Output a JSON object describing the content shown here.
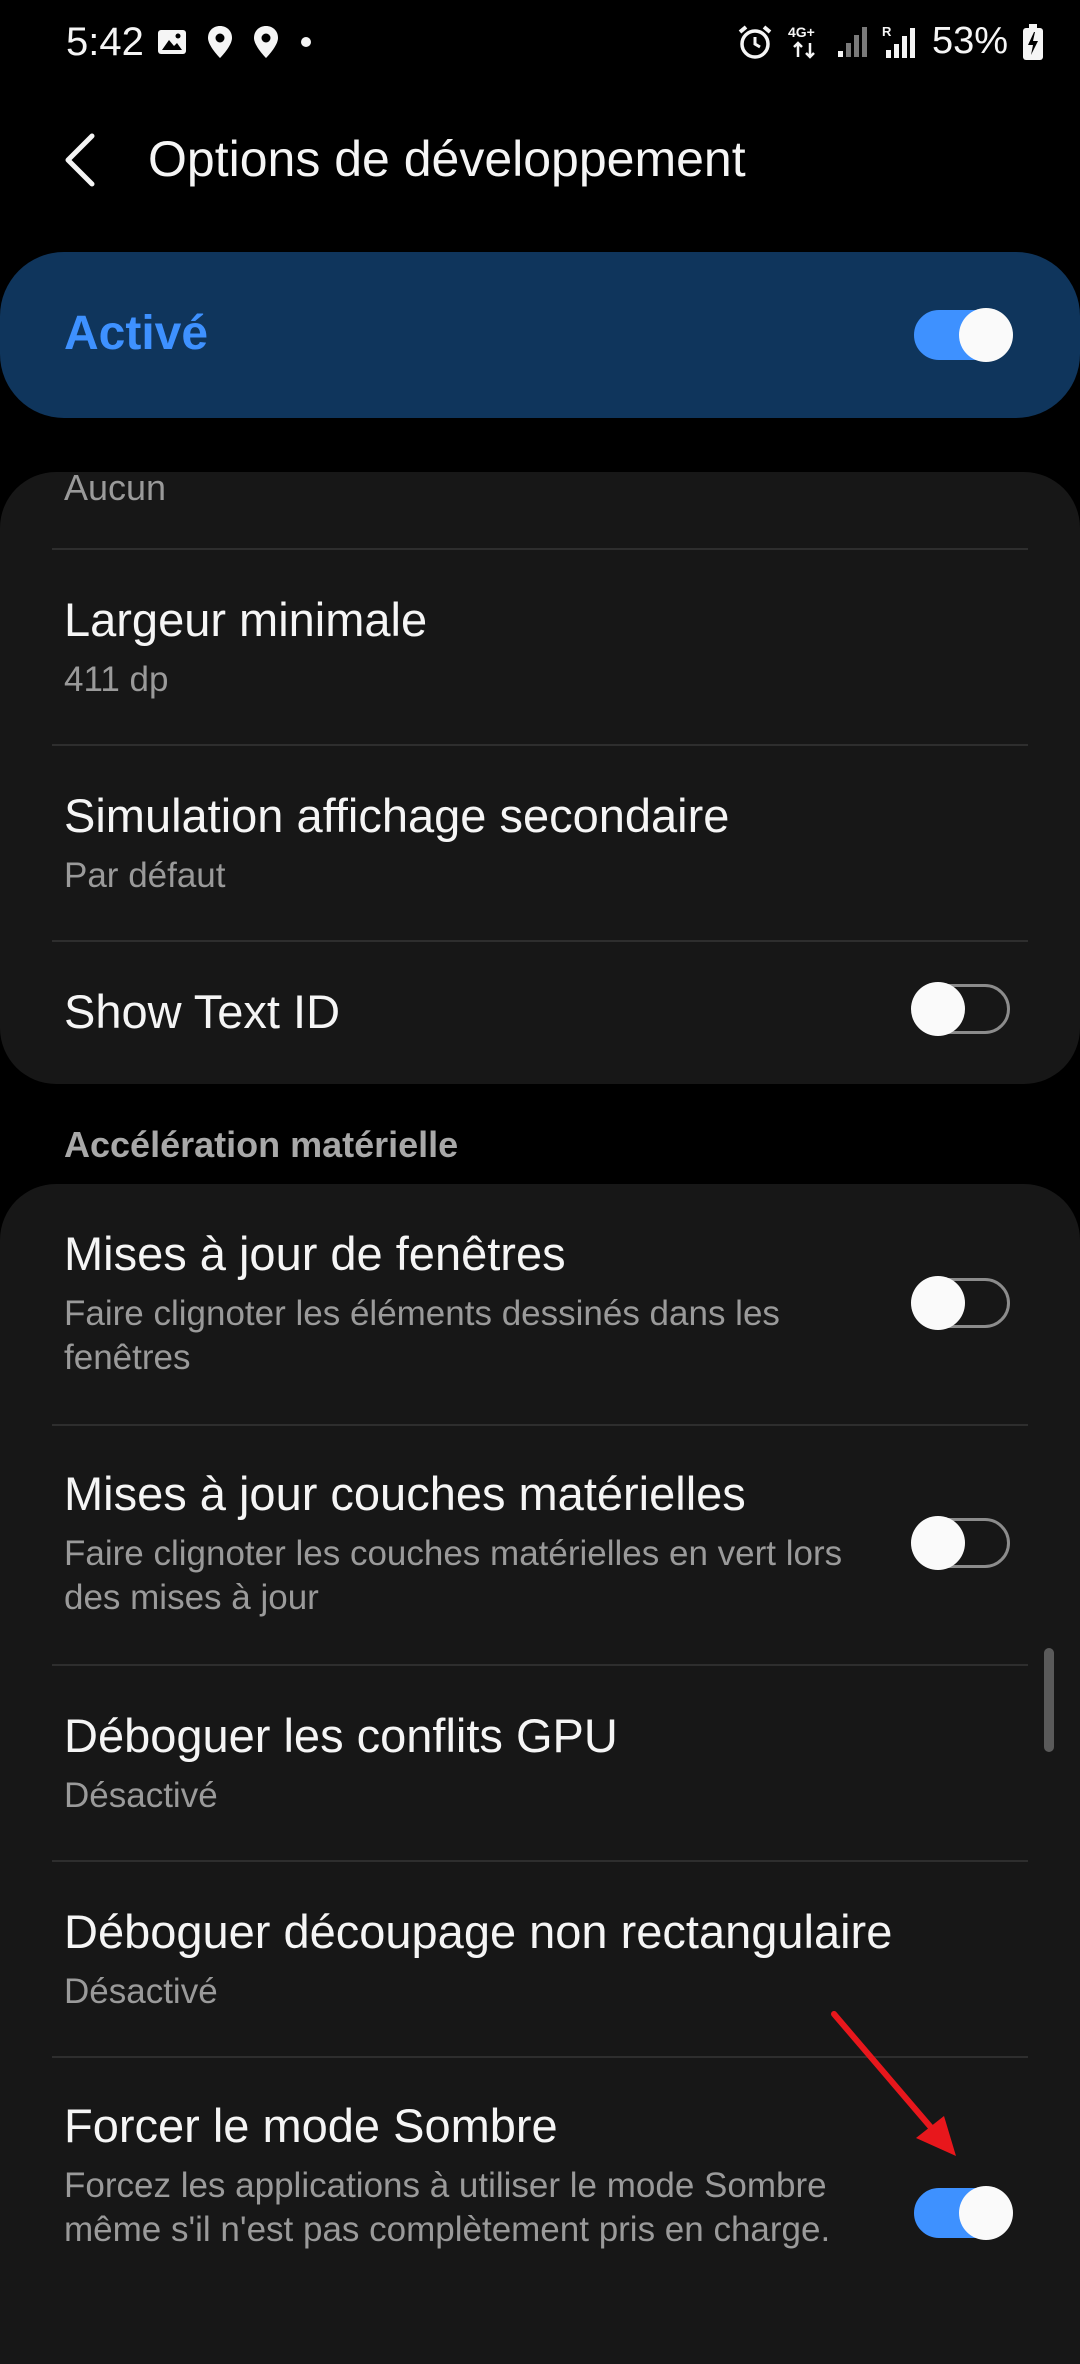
{
  "status_bar": {
    "time": "5:42",
    "battery": "53%",
    "left_icons": [
      "image-icon",
      "location-pin-icon",
      "location-pin-icon",
      "dot-icon"
    ],
    "right_icons": [
      "alarm-icon",
      "4g-plus-data-icon",
      "signal-icon",
      "signal-roaming-icon",
      "battery-charging-icon"
    ],
    "network_label": "4G+",
    "roaming_label": "R"
  },
  "header": {
    "title": "Options de développement"
  },
  "master_switch": {
    "label": "Activé",
    "on": true
  },
  "card1": {
    "partial_item": "Aucun",
    "items": [
      {
        "title": "Largeur minimale",
        "subtitle": "411 dp"
      },
      {
        "title": "Simulation affichage secondaire",
        "subtitle": "Par défaut"
      },
      {
        "title": "Show Text ID",
        "toggle": false
      }
    ]
  },
  "section": {
    "title": "Accélération matérielle"
  },
  "card2": {
    "items": [
      {
        "title": "Mises à jour de fenêtres",
        "subtitle": "Faire clignoter les éléments dessinés dans les fenêtres",
        "toggle": false
      },
      {
        "title": "Mises à jour couches matérielles",
        "subtitle": "Faire clignoter les couches matérielles en vert lors des mises à jour",
        "toggle": false
      },
      {
        "title": "Déboguer les conflits GPU",
        "subtitle": "Désactivé"
      },
      {
        "title": "Déboguer découpage non rectangulaire",
        "subtitle": "Désactivé"
      },
      {
        "title": "Forcer le mode Sombre",
        "subtitle": "Forcez les applications à utiliser le mode Sombre même s'il n'est pas complètement pris en charge.",
        "toggle": true
      }
    ]
  },
  "colors": {
    "accent": "#3e91ff",
    "master_card": "#0f355c",
    "card_bg": "#171717",
    "annotation_arrow": "#e8171c"
  }
}
